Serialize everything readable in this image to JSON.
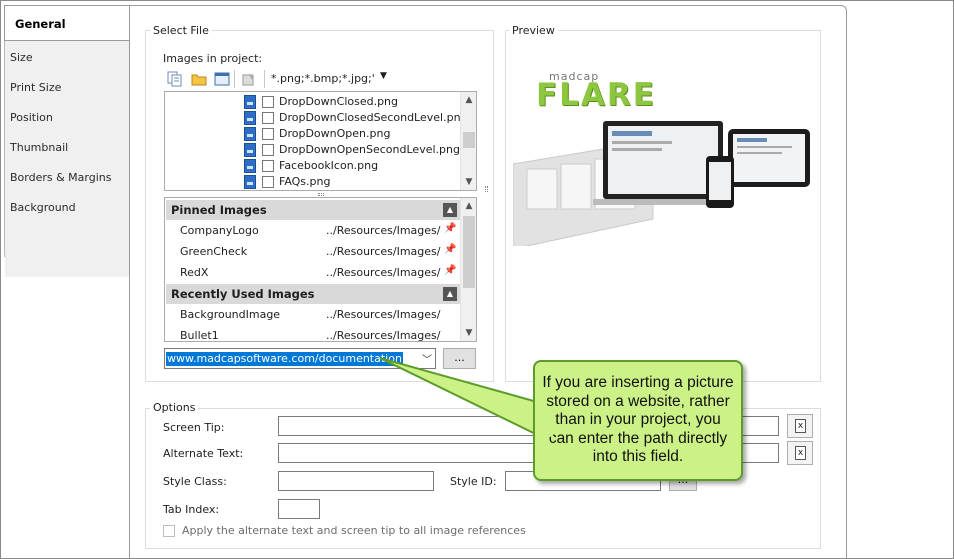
{
  "tabs": [
    {
      "label": "General",
      "active": true
    },
    {
      "label": "Size"
    },
    {
      "label": "Print Size"
    },
    {
      "label": "Position"
    },
    {
      "label": "Thumbnail"
    },
    {
      "label": "Borders & Margins"
    },
    {
      "label": "Background"
    }
  ],
  "select_file": {
    "title": "Select File",
    "images_label": "Images in project:",
    "filter": "*.png;*.bmp;*.jpg;'",
    "files": [
      "DropDownClosed.png",
      "DropDownClosedSecondLevel.png",
      "DropDownOpen.png",
      "DropDownOpenSecondLevel.png",
      "FacebookIcon.png",
      "FAQs.png"
    ],
    "pinned_header": "Pinned Images",
    "pinned": [
      {
        "name": "CompanyLogo",
        "path": "../Resources/Images/"
      },
      {
        "name": "GreenCheck",
        "path": "../Resources/Images/"
      },
      {
        "name": "RedX",
        "path": "../Resources/Images/"
      }
    ],
    "recent_header": "Recently Used Images",
    "recent": [
      {
        "name": "BackgroundImage",
        "path": "../Resources/Images/"
      },
      {
        "name": "Bullet1",
        "path": "../Resources/Images/"
      }
    ],
    "url_value": "www.madcapsoftware.com/documentation",
    "browse_label": "..."
  },
  "preview": {
    "title": "Preview",
    "logo_small": "madcap",
    "logo_big": "FLARE"
  },
  "options": {
    "title": "Options",
    "screen_tip_label": "Screen Tip:",
    "alt_text_label": "Alternate Text:",
    "style_class_label": "Style Class:",
    "style_id_label": "Style ID:",
    "style_id_btn": "...",
    "tab_index_label": "Tab Index:",
    "apply_label": "Apply the alternate text and screen tip to all image references"
  },
  "callout": {
    "text": "If you are inserting a picture stored on a website, rather than in your project, you can enter the path directly into this field."
  },
  "colors": {
    "callout_fill": "#ccf287",
    "callout_border": "#5d9c2a",
    "selection": "#0078d7",
    "flare_green": "#8dc63f"
  }
}
